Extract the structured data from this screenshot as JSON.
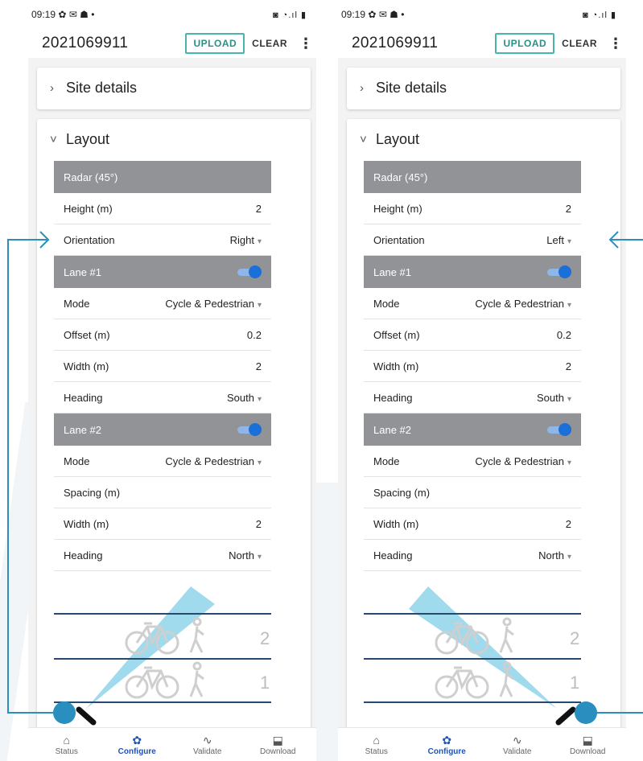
{
  "colors": {
    "accent_teal": "#48b6ad",
    "section_grey": "#919396",
    "toggle_blue": "#1b6fd8",
    "callout_blue": "#2a8fbf",
    "nav_active": "#2153b0",
    "cone": "#8fd3ea"
  },
  "screens": [
    {
      "status_time": "09:19",
      "app_title": "2021069911",
      "upload_label": "UPLOAD",
      "clear_label": "CLEAR",
      "site_details_label": "Site details",
      "layout_label": "Layout",
      "radar_label": "Radar (45°)",
      "height_label": "Height (m)",
      "height_value": "2",
      "orientation_label": "Orientation",
      "orientation_value": "Right",
      "lane1_label": "Lane #1",
      "lane1_mode_label": "Mode",
      "lane1_mode_value": "Cycle & Pedestrian",
      "lane1_offset_label": "Offset (m)",
      "lane1_offset_value": "0.2",
      "lane1_width_label": "Width (m)",
      "lane1_width_value": "2",
      "lane1_heading_label": "Heading",
      "lane1_heading_value": "South",
      "lane2_label": "Lane #2",
      "lane2_mode_label": "Mode",
      "lane2_mode_value": "Cycle & Pedestrian",
      "lane2_spacing_label": "Spacing (m)",
      "lane2_width_label": "Width (m)",
      "lane2_width_value": "2",
      "lane2_heading_label": "Heading",
      "lane2_heading_value": "North",
      "lane_number_2": "2",
      "lane_number_1": "1",
      "nav": [
        "Status",
        "Configure",
        "Validate",
        "Download"
      ]
    },
    {
      "status_time": "09:19",
      "app_title": "2021069911",
      "upload_label": "UPLOAD",
      "clear_label": "CLEAR",
      "site_details_label": "Site details",
      "layout_label": "Layout",
      "radar_label": "Radar (45°)",
      "height_label": "Height (m)",
      "height_value": "2",
      "orientation_label": "Orientation",
      "orientation_value": "Left",
      "lane1_label": "Lane #1",
      "lane1_mode_label": "Mode",
      "lane1_mode_value": "Cycle & Pedestrian",
      "lane1_offset_label": "Offset (m)",
      "lane1_offset_value": "0.2",
      "lane1_width_label": "Width (m)",
      "lane1_width_value": "2",
      "lane1_heading_label": "Heading",
      "lane1_heading_value": "South",
      "lane2_label": "Lane #2",
      "lane2_mode_label": "Mode",
      "lane2_mode_value": "Cycle & Pedestrian",
      "lane2_spacing_label": "Spacing (m)",
      "lane2_width_label": "Width (m)",
      "lane2_width_value": "2",
      "lane2_heading_label": "Heading",
      "lane2_heading_value": "North",
      "lane_number_2": "2",
      "lane_number_1": "1",
      "nav": [
        "Status",
        "Configure",
        "Validate",
        "Download"
      ]
    }
  ]
}
